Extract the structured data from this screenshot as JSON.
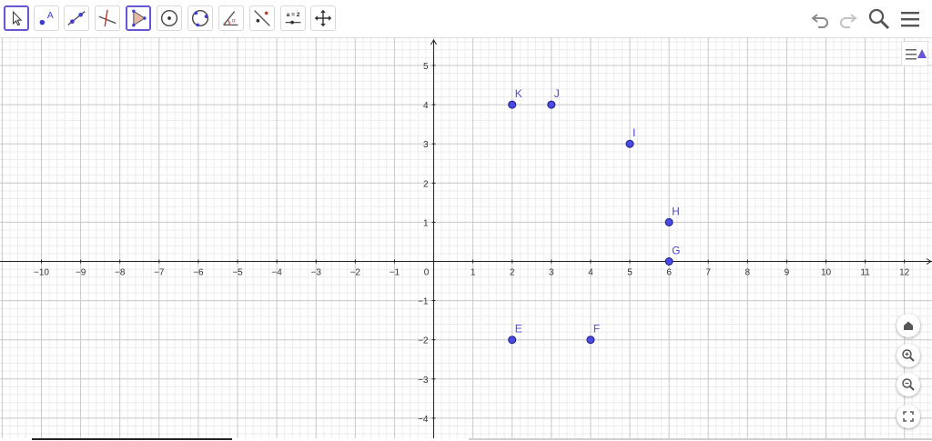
{
  "toolbar": {
    "tools": [
      {
        "name": "move-tool",
        "selected": true
      },
      {
        "name": "point-tool",
        "label": "A"
      },
      {
        "name": "line-tool"
      },
      {
        "name": "perpendicular-line-tool"
      },
      {
        "name": "polygon-tool",
        "selected": true
      },
      {
        "name": "circle-center-point-tool"
      },
      {
        "name": "circle-three-points-tool"
      },
      {
        "name": "angle-tool"
      },
      {
        "name": "reflect-tool"
      },
      {
        "name": "slider-tool",
        "label": "a = 2"
      },
      {
        "name": "move-graphics-view-tool"
      }
    ],
    "right": [
      "undo-icon",
      "redo-icon",
      "search-icon",
      "menu-icon"
    ]
  },
  "graphics": {
    "x_ticks": [
      "−10",
      "−9",
      "−8",
      "−7",
      "−6",
      "−5",
      "−4",
      "−3",
      "−2",
      "−1",
      "0",
      "1",
      "2",
      "3",
      "4",
      "5",
      "6",
      "7",
      "8",
      "9",
      "10",
      "11",
      "12"
    ],
    "y_ticks": [
      "5",
      "4",
      "3",
      "2",
      "1",
      "−1",
      "−2",
      "−3",
      "−4"
    ],
    "points": [
      {
        "label": "K",
        "x": 2,
        "y": 4
      },
      {
        "label": "J",
        "x": 3,
        "y": 4
      },
      {
        "label": "I",
        "x": 5,
        "y": 3
      },
      {
        "label": "H",
        "x": 6,
        "y": 1
      },
      {
        "label": "G",
        "x": 6,
        "y": 0
      },
      {
        "label": "E",
        "x": 2,
        "y": -2
      },
      {
        "label": "F",
        "x": 4,
        "y": -2
      }
    ],
    "point_color": "#4a4ae0",
    "label_color": "#4a4ae0",
    "grid_major": "#c8c8c8",
    "grid_minor": "#ececec"
  },
  "nav": [
    "home-icon",
    "zoom-in-icon",
    "zoom-out-icon",
    "fullscreen-icon"
  ]
}
